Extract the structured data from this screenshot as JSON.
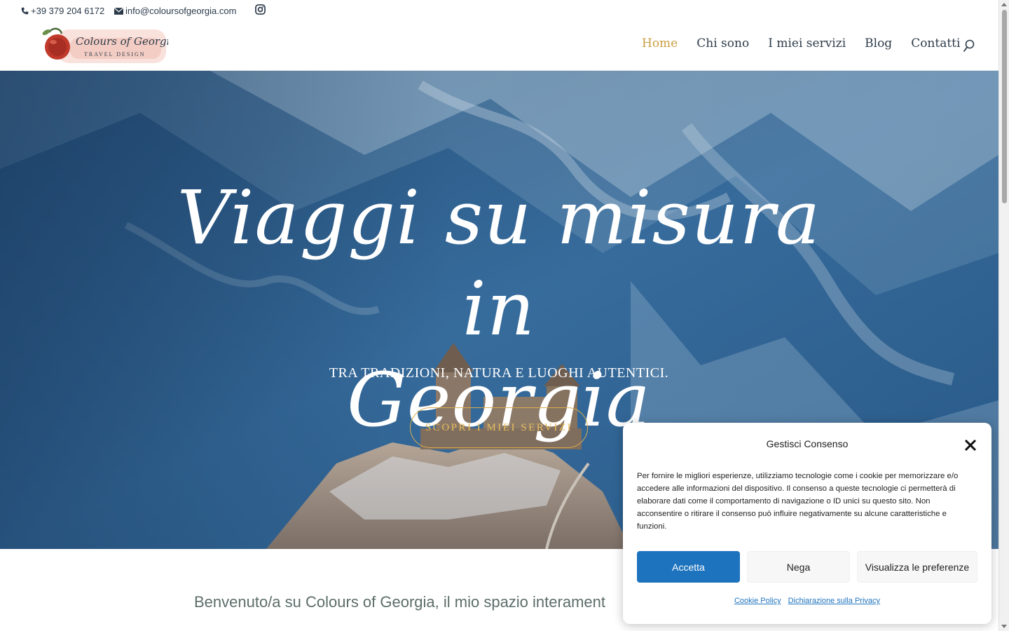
{
  "topbar": {
    "phone": "+39 379 204 6172",
    "email": "info@coloursofgeorgia.com",
    "icons": {
      "phone": "phone-icon",
      "email": "envelope-icon",
      "social": "instagram-icon"
    }
  },
  "logo": {
    "line1": "Colours of Georgia",
    "line2": "TRAVEL DESIGN"
  },
  "nav": {
    "items": [
      {
        "label": "Home",
        "active": true
      },
      {
        "label": "Chi sono"
      },
      {
        "label": "I miei servizi"
      },
      {
        "label": "Blog"
      },
      {
        "label": "Contatti"
      }
    ],
    "search_icon": "search-icon"
  },
  "hero": {
    "title_line1": "Viaggi su misura in",
    "title_line2": "Georgia",
    "subtitle": "TRA TRADIZIONI, NATURA E LUOGHI AUTENTICI.",
    "cta": "SCOPRI I MIEI SERVIZI"
  },
  "welcome": {
    "text": "Benvenuto/a su Colours of Georgia, il mio spazio interament"
  },
  "cookie": {
    "title": "Gestisci Consenso",
    "text": "Per fornire le migliori esperienze, utilizziamo tecnologie come i cookie per memorizzare e/o accedere alle informazioni del dispositivo. Il consenso a queste tecnologie ci permetterà di elaborare dati come il comportamento di navigazione o ID unici su questo sito. Non acconsentire o ritirare il consenso può influire negativamente su alcune caratteristiche e funzioni.",
    "accept": "Accetta",
    "deny": "Nega",
    "prefs": "Visualizza le preferenze",
    "link_cookie": "Cookie Policy",
    "link_privacy": "Dichiarazione sulla Privacy"
  },
  "colors": {
    "accent_gold": "#c9a042",
    "nav_text": "#2e3c4a",
    "button_blue": "#1e73be",
    "hero_blue": "#2f6497"
  }
}
